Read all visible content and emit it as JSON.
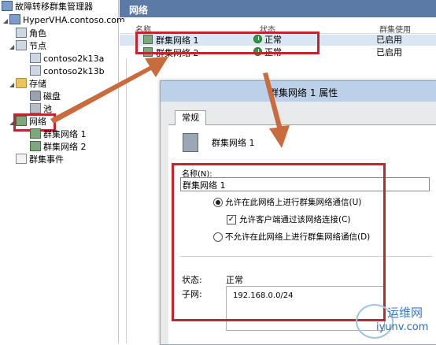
{
  "tree": {
    "root": "故障转移群集管理器",
    "cluster": "HyperVHA.contoso.com",
    "roles": "角色",
    "nodes": "节点",
    "node1": "contoso2k13a",
    "node2": "contoso2k13b",
    "storage": "存储",
    "disks": "磁盘",
    "pools": "池",
    "networks": "网络",
    "net1": "群集网络 1",
    "net2": "群集网络 2",
    "events": "群集事件"
  },
  "panel": {
    "title": "网络",
    "columns": [
      "名称",
      "状态",
      "群集使用"
    ],
    "rows": [
      {
        "name": "群集网络 1",
        "status": "正常",
        "use": "已启用"
      },
      {
        "name": "群集网络 2",
        "status": "正常",
        "use": "已启用"
      }
    ]
  },
  "dialog": {
    "title": "群集网络 1 属性",
    "tab": "常规",
    "heading": "群集网络 1",
    "name_label": "名称(N):",
    "name_value": "群集网络 1",
    "opt_allow": "允许在此网络上进行群集网络通信(U)",
    "opt_client": "允许客户端通过该网络连接(C)",
    "opt_deny": "不允许在此网络上进行群集网络通信(D)",
    "status_label": "状态:",
    "status_value": "正常",
    "subnet_label": "子网:",
    "subnet_value": "192.168.0.0/24"
  },
  "watermark": {
    "line1": "运维网",
    "line2": "iyunv.com"
  },
  "colors": {
    "highlight": "#c0262d",
    "header": "#5b7aa5",
    "ok": "#2e9e3d"
  }
}
